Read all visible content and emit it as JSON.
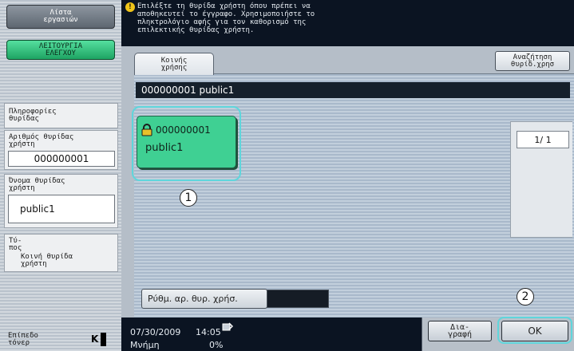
{
  "sidebar": {
    "utility_button": "Λίστα\nεργασιών",
    "check_button": "ΛΕΙΤΟΥΡΓΙΑ\nΕΛΕΓΧΟΥ",
    "info_heading": "Πληροφορίες\nθυρίδας",
    "box_number_label": "Αριθμός θυρίδας\nχρήστη",
    "box_number_value": "000000001",
    "box_name_label": "Όνομα θυρίδας\nχρήστη",
    "box_name_value": "public1",
    "type_label": "Τύ-\nπος",
    "type_value": "Κοινή θυρίδα\nχρήστη",
    "toner_label": "Επίπεδο\nτόνερ",
    "toner_indicator": "K"
  },
  "header": {
    "message": "Επιλέξτε τη θυρίδα χρήστη όπου πρέπει να\nαποθηκευτεί το έγγραφο. Χρησιμοποιήστε το\nπληκτρολόγιο αφής για τον καθορισμό της\nεπιλεκτικής θυρίδας χρήστη."
  },
  "main": {
    "tab_label": "Κοινής\nχρήσης",
    "search_button": "Αναζήτηση\nθυρίδ.χρησ",
    "selected_title": "000000001   public1",
    "box": {
      "number": "000000001",
      "name": "public1"
    },
    "page_indicator": "1/  1",
    "callout_1": "1",
    "callout_2": "2",
    "bottom_button": "Ρύθμ. αρ. θυρ. χρήσ."
  },
  "footer": {
    "date": "07/30/2009",
    "time": "14:05",
    "memory_label": "Μνήμη",
    "memory_value": "0%",
    "delete_button": "Δια-\nγραφή",
    "ok_button": "OK"
  }
}
